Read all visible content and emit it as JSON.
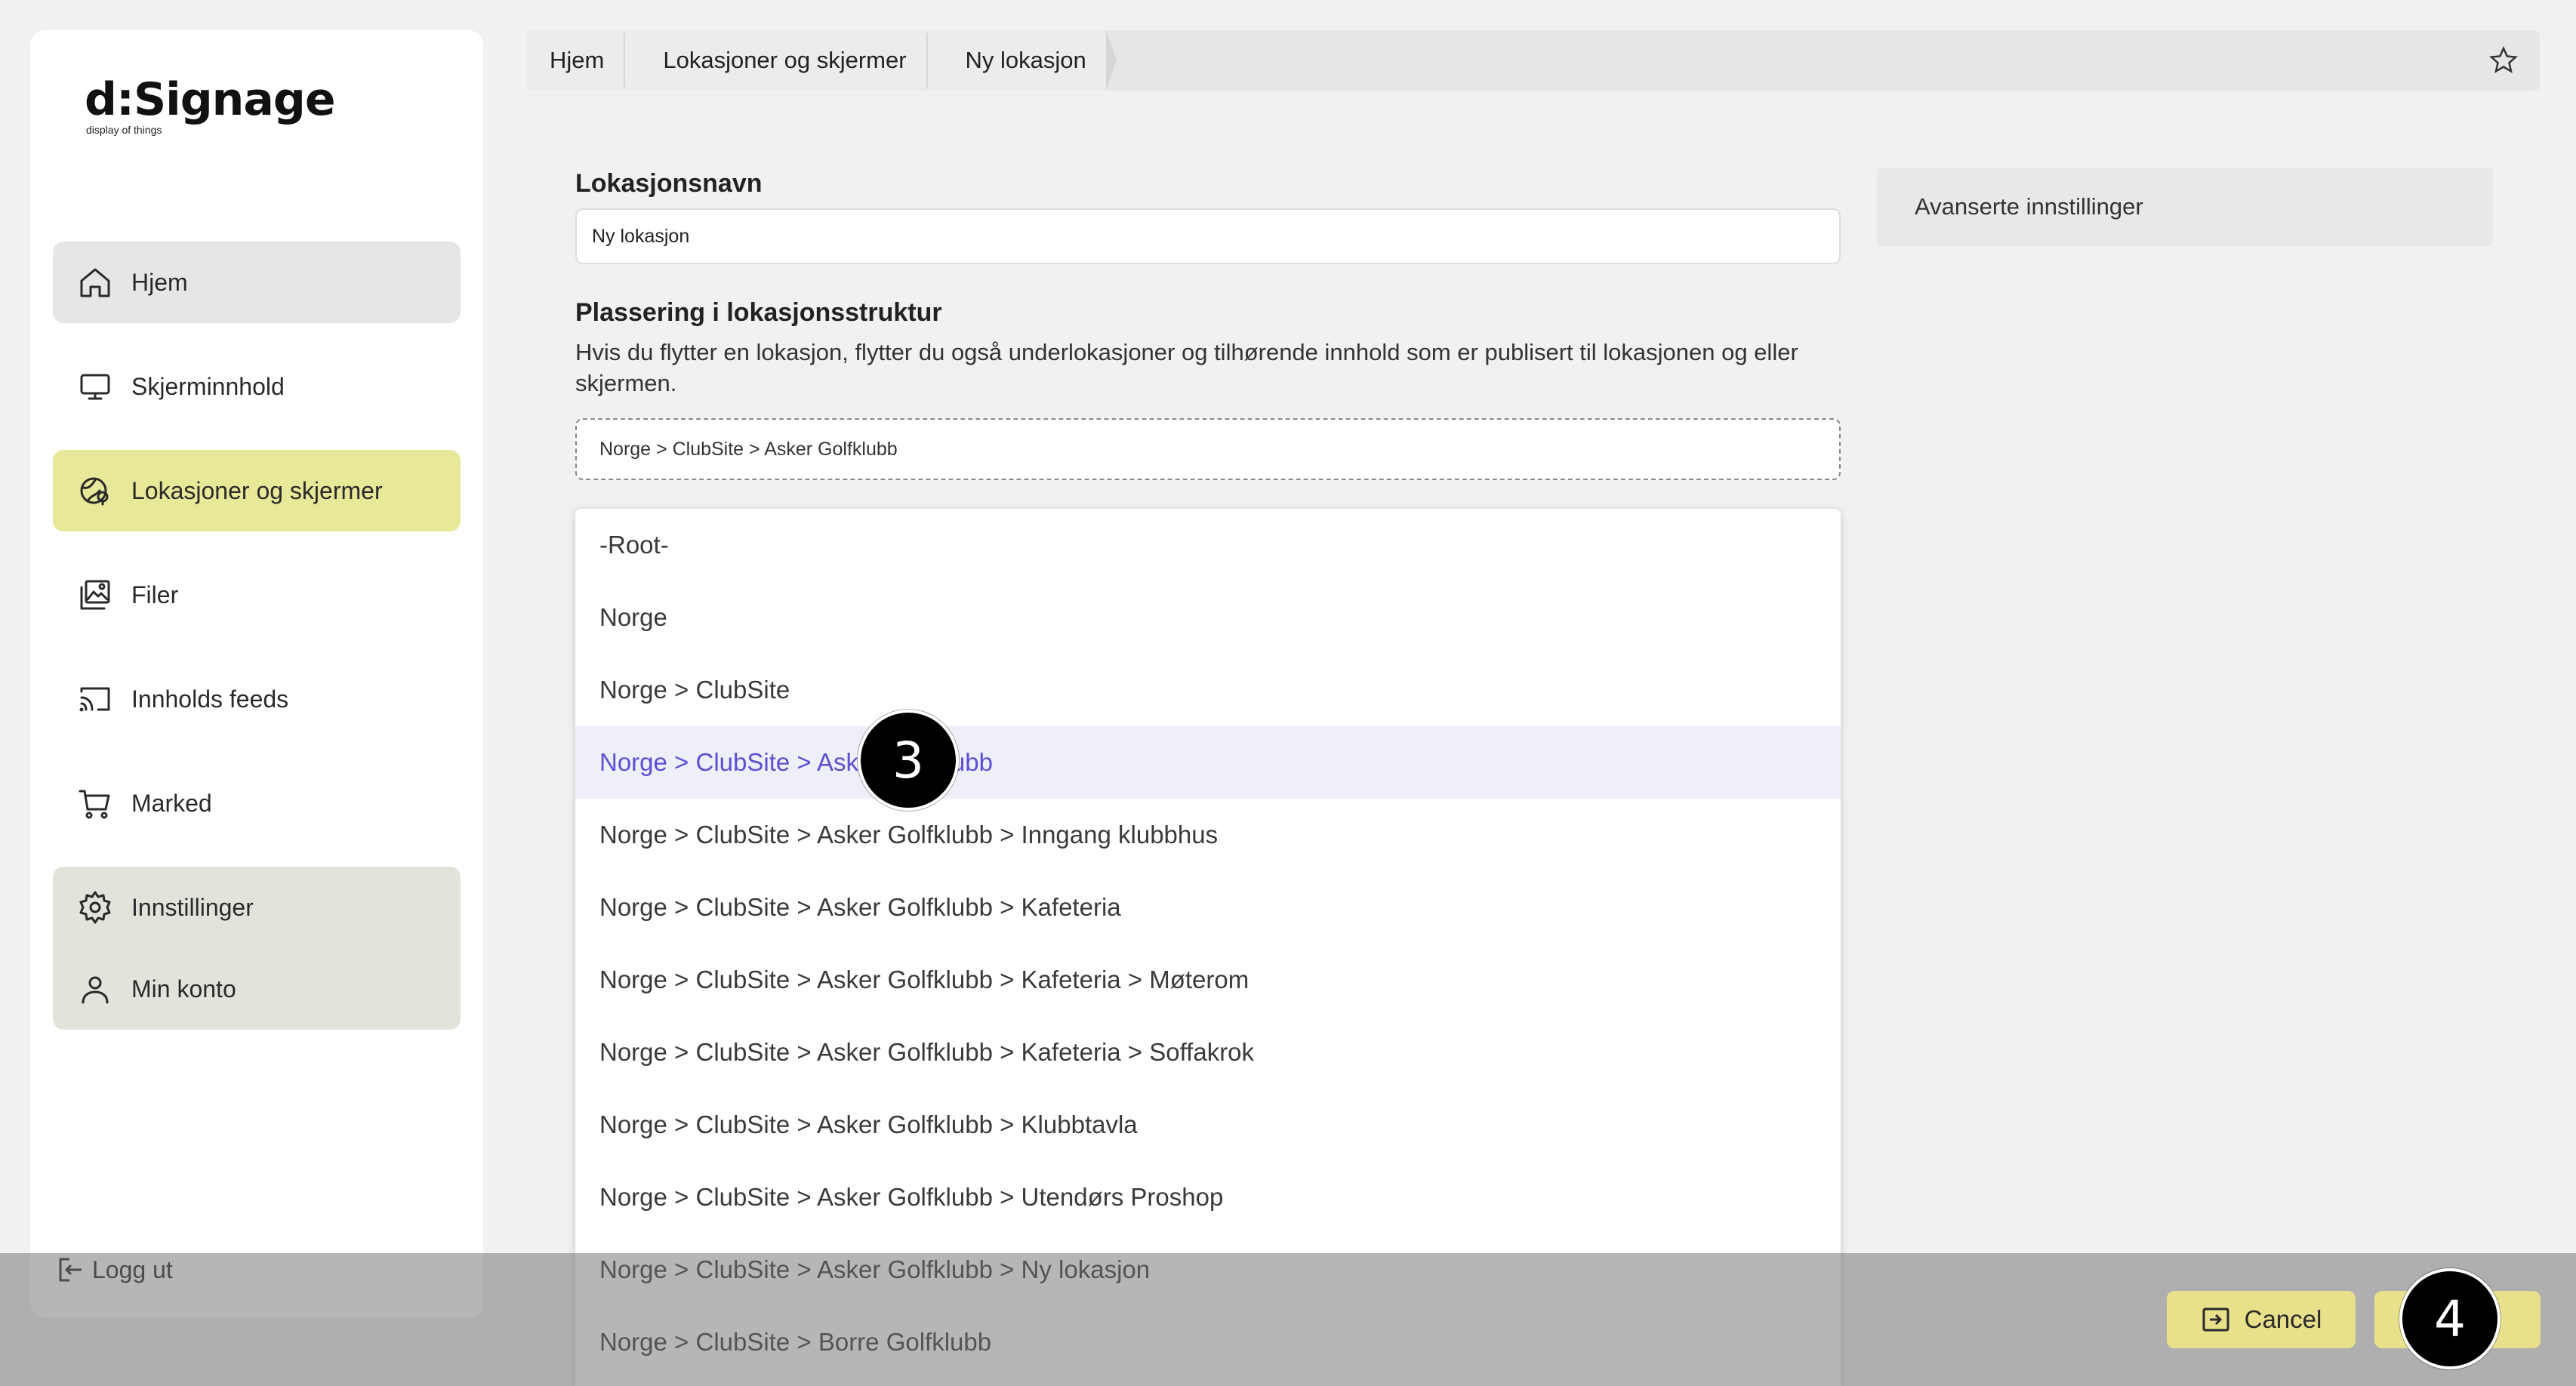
{
  "app": {
    "logo_text": "d:Signage",
    "logo_tagline": "display of things"
  },
  "sidebar": {
    "items": [
      {
        "label": "Hjem",
        "icon": "home-icon"
      },
      {
        "label": "Skjerminnhold",
        "icon": "monitor-icon"
      },
      {
        "label": "Lokasjoner og skjermer",
        "icon": "location-icon"
      },
      {
        "label": "Filer",
        "icon": "images-icon"
      },
      {
        "label": "Innholds feeds",
        "icon": "cast-icon"
      },
      {
        "label": "Marked",
        "icon": "cart-icon"
      },
      {
        "label": "Innstillinger",
        "icon": "gear-icon"
      },
      {
        "label": "Min konto",
        "icon": "user-icon"
      }
    ],
    "logout_label": "Logg ut",
    "active_color": "#e8e899"
  },
  "breadcrumb": {
    "items": [
      "Hjem",
      "Lokasjoner og skjermer",
      "Ny lokasjon"
    ]
  },
  "form": {
    "name_label": "Lokasjonsnavn",
    "name_value": "Ny lokasjon",
    "placement_label": "Plassering i lokasjonsstruktur",
    "placement_help": "Hvis du flytter en lokasjon, flytter du også underlokasjoner og tilhørende innhold som er publisert til lokasjonen og eller skjermen.",
    "placement_value": "Norge > ClubSite > Asker Golfklubb"
  },
  "dropdown": {
    "options": [
      "-Root-",
      "Norge",
      "Norge > ClubSite",
      "Norge > ClubSite > Asker Golfklubb",
      "Norge > ClubSite > Asker Golfklubb > Inngang klubbhus",
      "Norge > ClubSite > Asker Golfklubb > Kafeteria",
      "Norge > ClubSite > Asker Golfklubb > Kafeteria > Møterom",
      "Norge > ClubSite > Asker Golfklubb > Kafeteria > Soffakrok",
      "Norge > ClubSite > Asker Golfklubb > Klubbtavla",
      "Norge > ClubSite > Asker Golfklubb > Utendørs Proshop",
      "Norge > ClubSite > Asker Golfklubb > Ny lokasjon",
      "Norge > ClubSite > Borre Golfklubb"
    ],
    "selected_index": 3,
    "selected_color": "#5b4fd3"
  },
  "advanced": {
    "label": "Avanserte innstillinger"
  },
  "actions": {
    "cancel_label": "Cancel",
    "save_label": ""
  },
  "steps": {
    "step3": "3",
    "step4": "4"
  }
}
